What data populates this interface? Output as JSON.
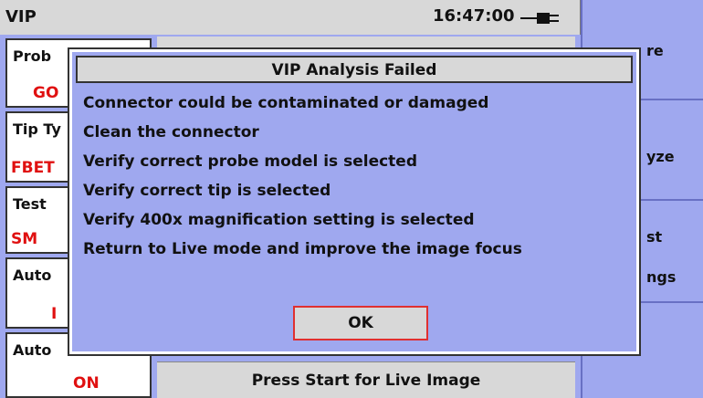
{
  "titlebar": {
    "title": "VIP",
    "time": "16:47:00"
  },
  "left": {
    "probe": {
      "label": "Prob",
      "value": "GO"
    },
    "tip": {
      "label": "Tip Ty",
      "value": "FBET"
    },
    "test": {
      "label": "Test",
      "value": "SM"
    },
    "auto1": {
      "label": "Auto",
      "value": "I"
    },
    "auto2": {
      "label": "Auto",
      "value": "ON"
    }
  },
  "center_bottom": {
    "text": "Press Start for Live Image"
  },
  "right": {
    "btn1": "re",
    "btn2": "yze",
    "btn3a": "st",
    "btn3b": "ngs"
  },
  "dialog": {
    "title": "VIP Analysis Failed",
    "lines": [
      "Connector could be contaminated or damaged",
      "Clean the connector",
      "Verify correct probe model is selected",
      "Verify correct tip is selected",
      "Verify 400x magnification setting is selected",
      "Return to Live mode and improve the image focus"
    ],
    "ok_label": "OK"
  },
  "colors": {
    "background": "#9fa8ef",
    "panel": "#d8d8d8",
    "alert": "#e01010"
  },
  "icons": {
    "power": "power-plug-icon"
  }
}
